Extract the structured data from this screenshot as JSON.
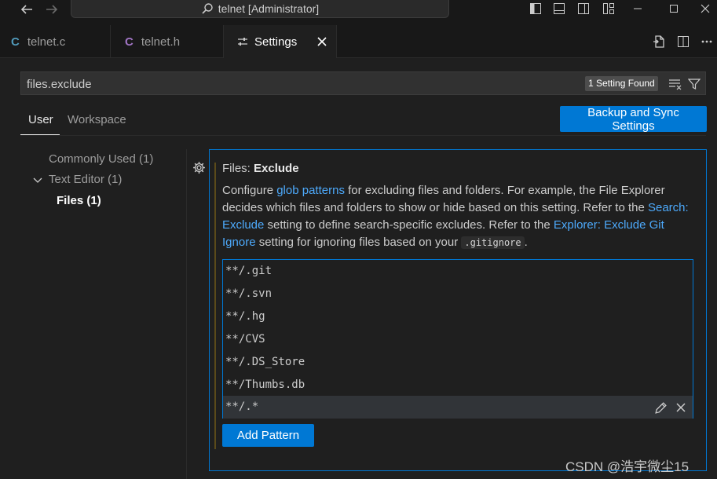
{
  "window": {
    "title": "telnet [Administrator]"
  },
  "tabs": [
    {
      "lang": "C",
      "label": "telnet.c",
      "lang_color": "#519aba"
    },
    {
      "lang": "C",
      "label": "telnet.h",
      "lang_color": "#a074c4"
    },
    {
      "label": "Settings",
      "active": true
    }
  ],
  "search": {
    "value": "files.exclude",
    "found_badge": "1 Setting Found"
  },
  "scope": {
    "user": "User",
    "workspace": "Workspace",
    "backup_button": "Backup and Sync Settings"
  },
  "toc": {
    "commonly_used": "Commonly Used (1)",
    "text_editor": "Text Editor (1)",
    "files_label": "Files",
    "files_count": "(1)"
  },
  "setting": {
    "category": "Files: ",
    "name": "Exclude",
    "desc_1": "Configure ",
    "link_glob": "glob patterns",
    "desc_2": " for excluding files and folders. For example, the File Explorer decides which files and folders to show or hide based on this setting. Refer to the ",
    "link_search_exclude": "Search: Exclude",
    "desc_3": " setting to define search-specific excludes. Refer to the ",
    "link_explorer_git": "Explorer: Exclude Git Ignore",
    "desc_4": " setting for ignoring files based on your ",
    "code_gitignore": ".gitignore",
    "desc_5": "."
  },
  "patterns": [
    "**/.git",
    "**/.svn",
    "**/.hg",
    "**/CVS",
    "**/.DS_Store",
    "**/Thumbs.db",
    "**/.*"
  ],
  "add_pattern_button": "Add Pattern",
  "watermark": "CSDN @浩宇微尘15",
  "colors": {
    "accent": "#0078d4",
    "link": "#4daafc",
    "background": "#1f1f1f"
  }
}
